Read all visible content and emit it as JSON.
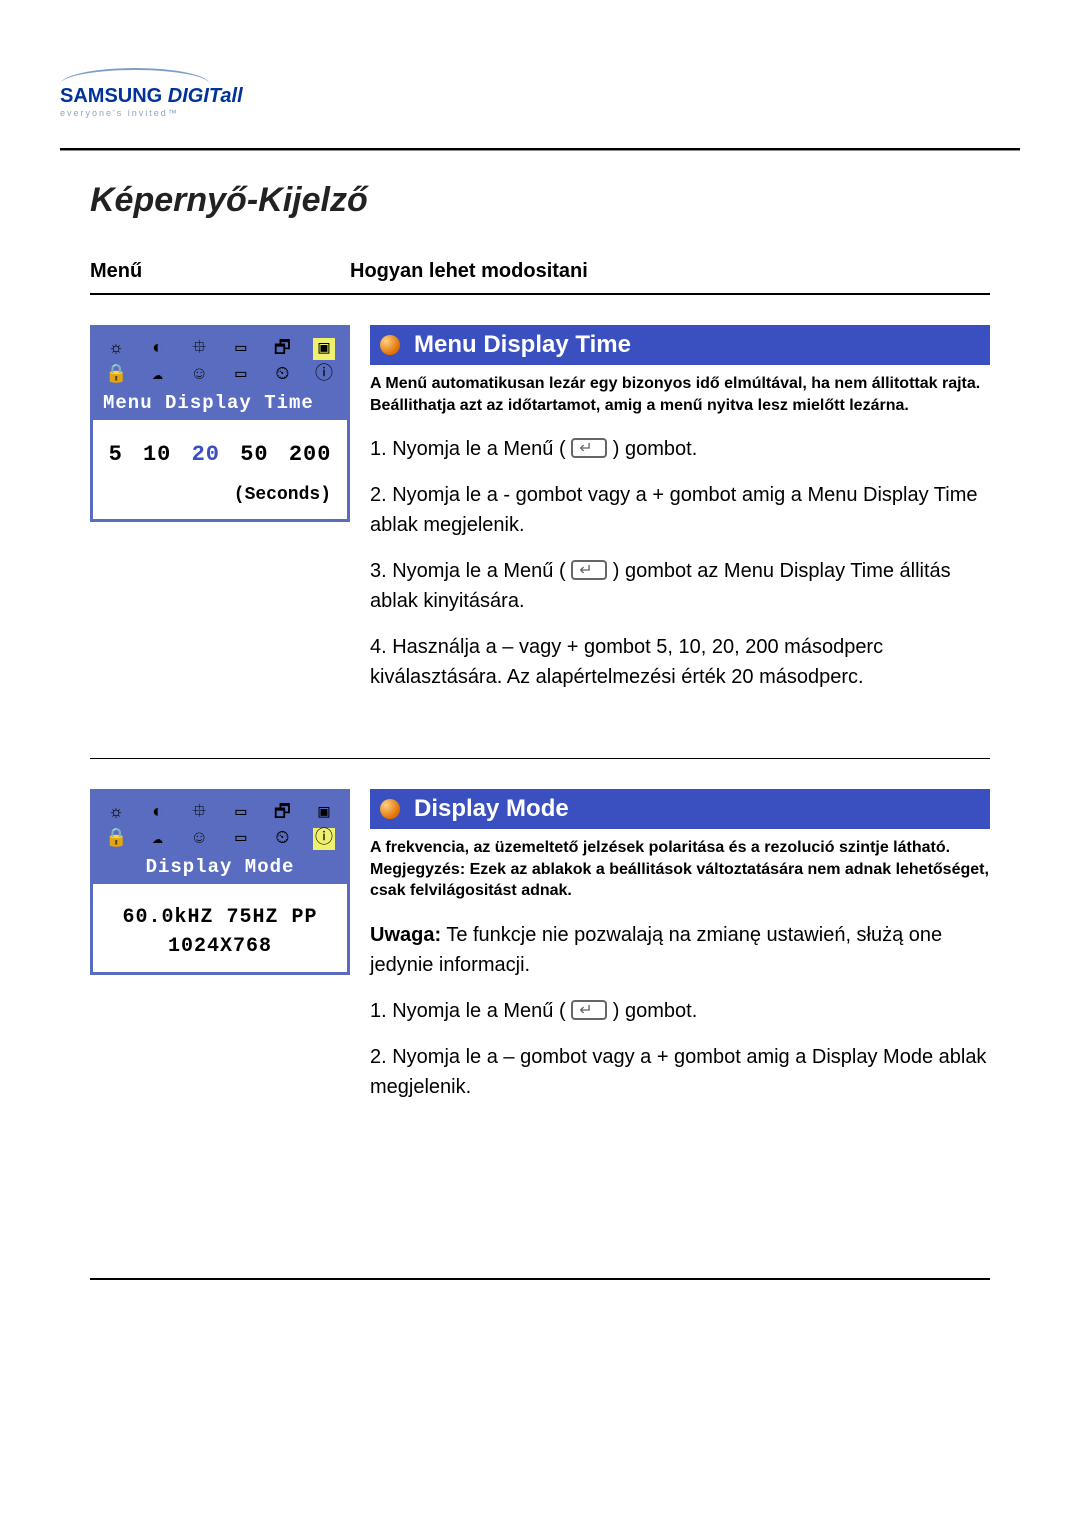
{
  "logo": {
    "brand_main": "SAMSUNG ",
    "brand_sub": "DIGITall",
    "tagline": "everyone's invited™"
  },
  "page_title": "Képernyő-Kijelző",
  "col_headers": {
    "left": "Menű",
    "right": "Hogyan lehet modositani"
  },
  "section1": {
    "osd": {
      "title": "Menu Display Time",
      "values": [
        "5",
        "10",
        "20",
        "50",
        "200"
      ],
      "selected_index": 2,
      "unit_label": "(Seconds)"
    },
    "heading": "Menu Display Time",
    "description": "A Menű automatikusan lezár egy bizonyos idő elmúltával, ha nem állitottak rajta. Beállithatja azt az időtartamot, amig a menű nyitva lesz mielőtt lezárna.",
    "steps": {
      "s1a": "1. Nyomja le a Menű  ( ",
      "s1b": " ) gombot.",
      "s2": "2. Nyomja le a - gombot vagy a + gombot amig a Menu Display Time ablak megjelenik.",
      "s3a": "3. Nyomja le a Menű ( ",
      "s3b": " ) gombot az Menu Display Time állitás ablak kinyitására.",
      "s4": "4. Használja a – vagy + gombot 5, 10, 20, 200 másodperc kiválasztására. Az alapértelmezési érték 20 másodperc."
    }
  },
  "section2": {
    "osd": {
      "title": "Display Mode",
      "line1": "60.0kHZ 75HZ PP",
      "line2": "1024X768"
    },
    "heading": "Display Mode",
    "description": "A frekvencia, az üzemeltető jelzések polaritása és a rezolució szintje látható. Megjegyzés: Ezek az ablakok a beállitások változtatására nem adnak lehetőséget, csak felvilágositást adnak.",
    "note_bold": "Uwaga:",
    "note_text": " Te funkcje nie pozwalają na zmianę ustawień, służą one jedynie informacji.",
    "steps": {
      "s1a": "1. Nyomja le a Menű  ( ",
      "s1b": " ) gombot.",
      "s2": "2. Nyomja le a – gombot vagy a + gombot amig a Display Mode ablak megjelenik."
    }
  },
  "icons": {
    "row1": [
      "☼",
      "◐",
      "⯐",
      "▭",
      "🗗",
      "▣"
    ],
    "row2": [
      "🔒",
      "☁",
      "☺",
      "▭",
      "⏲",
      "ⓘ"
    ]
  }
}
